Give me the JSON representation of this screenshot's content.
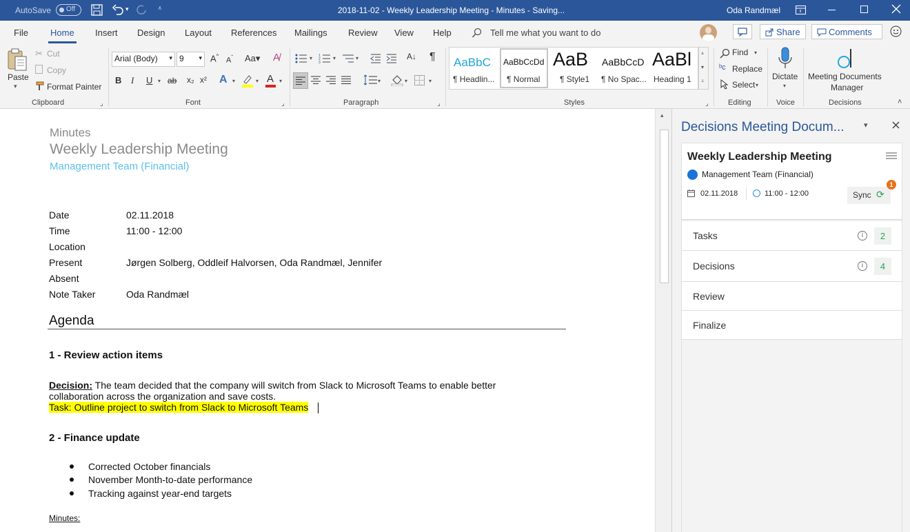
{
  "titlebar": {
    "autosave_label": "AutoSave",
    "autosave_state": "Off",
    "doc_title": "2018-11-02 - Weekly Leadership Meeting - Minutes  -  Saving...",
    "user_name": "Oda Randmæl"
  },
  "tabs": [
    "File",
    "Home",
    "Insert",
    "Design",
    "Layout",
    "References",
    "Mailings",
    "Review",
    "View",
    "Help"
  ],
  "active_tab": "Home",
  "search_placeholder": "Tell me what you want to do",
  "share_label": "Share",
  "comments_label": "Comments",
  "ribbon": {
    "clipboard": {
      "paste": "Paste",
      "cut": "Cut",
      "copy": "Copy",
      "format_painter": "Format Painter",
      "group": "Clipboard"
    },
    "font": {
      "family": "Arial (Body)",
      "size": "9",
      "group": "Font",
      "bold": "B",
      "italic": "I",
      "underline": "U",
      "strike": "ab",
      "sub": "x₂",
      "sup": "x²"
    },
    "paragraph": {
      "group": "Paragraph"
    },
    "styles": {
      "group": "Styles",
      "items": [
        {
          "preview": "AaBbC",
          "name": "¶ Headlin..."
        },
        {
          "preview": "AaBbCcDd",
          "name": "¶ Normal"
        },
        {
          "preview": "AaB",
          "name": "¶ Style1"
        },
        {
          "preview": "AaBbCcD",
          "name": "¶ No Spac..."
        },
        {
          "preview": "AaBl",
          "name": "Heading 1"
        }
      ]
    },
    "editing": {
      "find": "Find",
      "replace": "Replace",
      "select": "Select",
      "group": "Editing"
    },
    "voice": {
      "dictate": "Dictate",
      "group": "Voice"
    },
    "decisions": {
      "label1": "Meeting Documents",
      "label2": "Manager",
      "group": "Decisions"
    }
  },
  "doc": {
    "kind": "Minutes",
    "title": "Weekly Leadership Meeting",
    "subtitle": "Management Team (Financial)",
    "fields": [
      {
        "label": "Date",
        "value": "02.11.2018"
      },
      {
        "label": "Time",
        "value": "11:00 - 12:00"
      },
      {
        "label": "Location",
        "value": ""
      },
      {
        "label": "Present",
        "value": "Jørgen Solberg, Oddleif Halvorsen, Oda Randmæl, Jennifer"
      },
      {
        "label": "Absent",
        "value": ""
      },
      {
        "label": "Note Taker",
        "value": "Oda Randmæl"
      }
    ],
    "agenda_heading": "Agenda",
    "item1_heading": "1 - Review action items",
    "decision_label": "Decision:",
    "decision_text1": " The team decided that the company will switch from Slack to Microsoft Teams to enable better",
    "decision_text2": "collaboration across the organization and save costs.",
    "task_text": "Task: Outline project to switch from Slack to Microsoft Teams",
    "item2_heading": "2 - Finance update",
    "bullets": [
      "Corrected October financials",
      "November Month-to-date performance",
      "Tracking against year-end targets"
    ],
    "minutes_label": "Minutes:"
  },
  "pane": {
    "title": "Decisions Meeting Docum...",
    "meeting_title": "Weekly Leadership Meeting",
    "team": "Management Team (Financial)",
    "date": "02.11.2018",
    "time": "11:00 - 12:00",
    "sync_label": "Sync",
    "sync_badge": "1",
    "rows": [
      {
        "label": "Tasks",
        "count": "2"
      },
      {
        "label": "Decisions",
        "count": "4"
      },
      {
        "label": "Review",
        "count": ""
      },
      {
        "label": "Finalize",
        "count": ""
      }
    ]
  },
  "colors": {
    "titlebar": "#2b579a",
    "accent": "#2b579a",
    "subtitle": "#5bc0eb",
    "highlight": "#ffff00",
    "count_green": "#2e9e58",
    "badge": "#e8711a"
  }
}
